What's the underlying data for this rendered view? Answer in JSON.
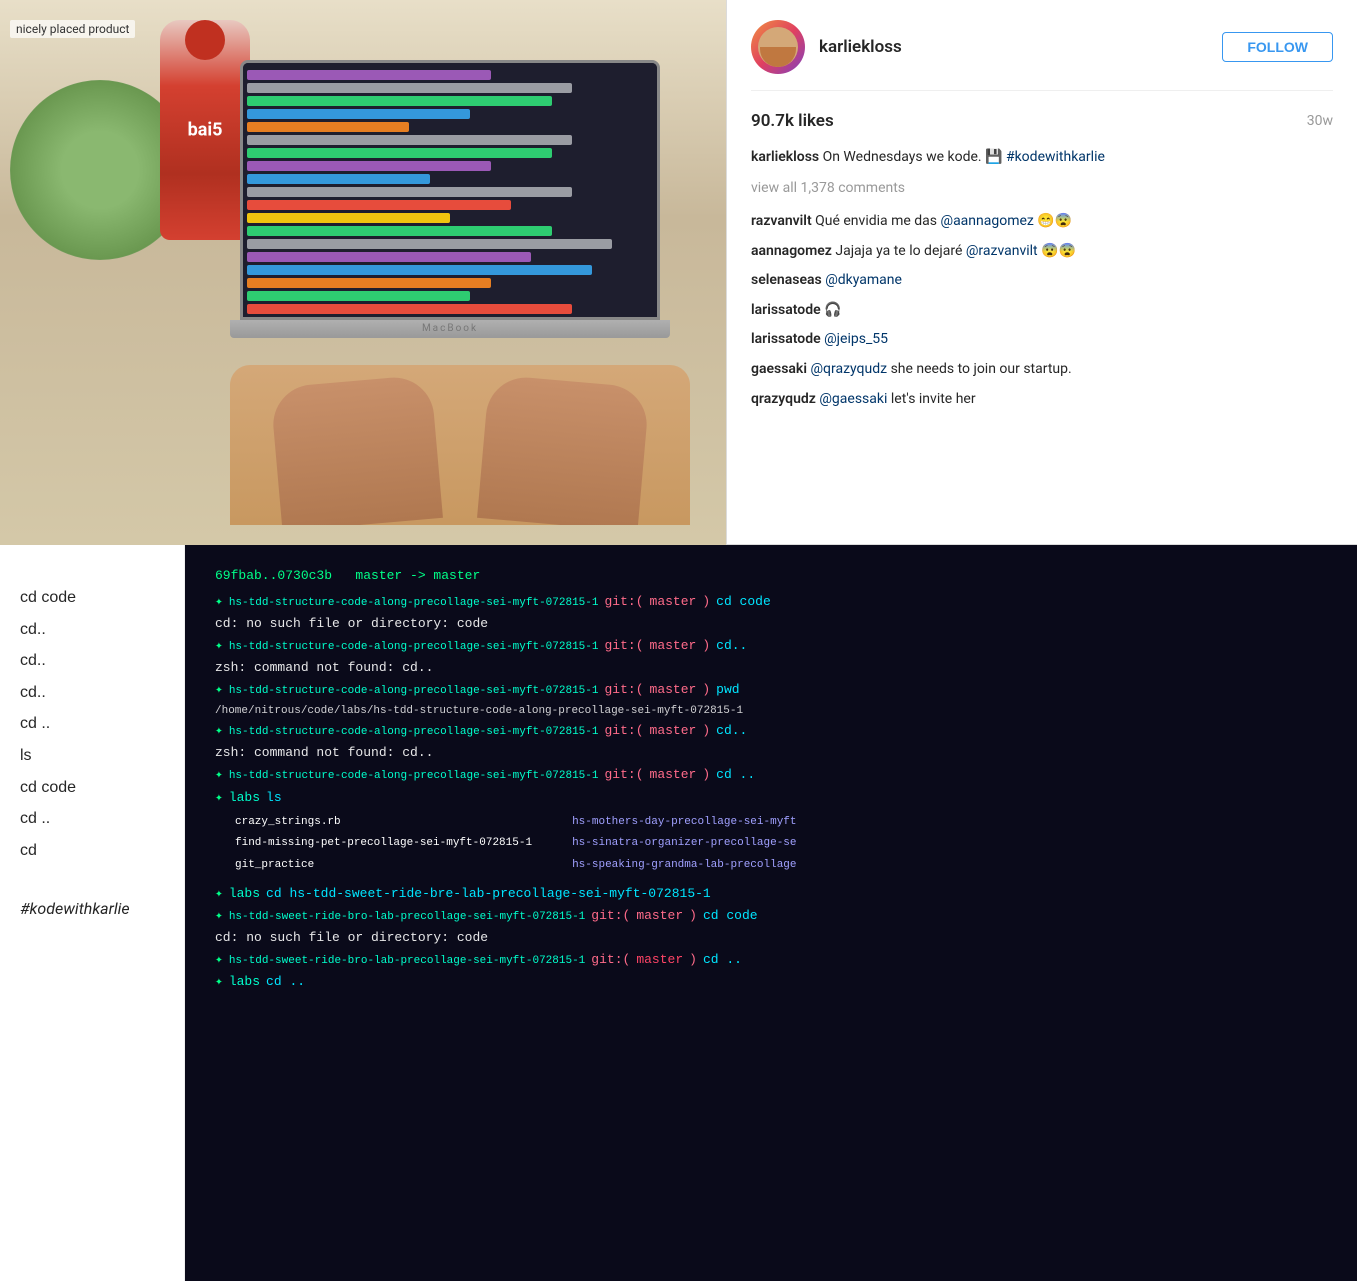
{
  "page": {
    "top_photo": {
      "product_label": "nicely placed product",
      "bottle_brand": "bai5",
      "laptop_brand": "MacBook"
    },
    "instagram": {
      "username": "karliekloss",
      "follow_btn": "FOLLOW",
      "likes": "90.7k likes",
      "time_ago": "30w",
      "caption_user": "karliekloss",
      "caption_text": "On Wednesdays we kode. 💾",
      "caption_hashtag": "#kodewithkarlie",
      "view_comments": "view all 1,378 comments",
      "comments": [
        {
          "user": "razvanvilt",
          "text": "Qué envidia me das @aannagomez 😁😨"
        },
        {
          "user": "aannagomez",
          "text": "Jajaja ya te lo dejaré @razvanvilt 😨😨"
        },
        {
          "user": "selenaseas",
          "text": "@dkyamane"
        },
        {
          "user": "larissatode",
          "text": "🎧"
        },
        {
          "user": "larissatode",
          "text": "@jeips_55"
        },
        {
          "user": "gaessaki",
          "text": "@qrazyqudz she needs to join our startup."
        },
        {
          "user": "qrazyqudz",
          "text": "@gaessaki let's invite her"
        }
      ]
    },
    "bottom": {
      "left_commands": [
        "cd code",
        "cd..",
        "cd..",
        "cd..",
        "cd ..",
        "ls",
        "cd code",
        "cd ..",
        "cd"
      ],
      "hashtag": "#kodewithkarlie",
      "terminal_lines": [
        {
          "type": "header",
          "text": "69fbab..0730c3b  master -> master"
        },
        {
          "type": "prompt",
          "prompt": "hs-tdd-structure-code-along-precollage-sei-myft-072815-1 git:(master)",
          "cmd": "cd code"
        },
        {
          "type": "error",
          "text": "cd: no such file or directory: code"
        },
        {
          "type": "prompt",
          "prompt": "hs-tdd-structure-code-along-precollage-sei-myft-072815-1 git:(master)",
          "cmd": "cd.."
        },
        {
          "type": "error",
          "text": "zsh: command not found: cd.."
        },
        {
          "type": "prompt",
          "prompt": "hs-tdd-structure-code-along-precollage-sei-myft-072815-1 git:(master)",
          "cmd": "cd.."
        },
        {
          "type": "error",
          "text": "zsh: command not found: cd.."
        },
        {
          "type": "prompt",
          "prompt": "hs-tdd-structure-code-along-precollage-sei-myft-072815-1 git:(master)",
          "cmd": "pwd"
        },
        {
          "type": "path",
          "text": "/home/nitrous/code/labs/hs-tdd-structure-code-along-precollage-sei-myft-072815-1"
        },
        {
          "type": "prompt",
          "prompt": "hs-tdd-structure-code-along-precollage-sei-myft-072815-1 git:(master)",
          "cmd": "cd.."
        },
        {
          "type": "error",
          "text": "zsh: command not found: cd.."
        },
        {
          "type": "prompt",
          "prompt": "hs-tdd-structure-code-along-precollage-sei-myft-072815-1 git:(master)",
          "cmd": "cd .."
        },
        {
          "type": "bullet",
          "cmd": "labs",
          "action": "ls"
        },
        {
          "type": "file_row",
          "files": [
            "crazy_strings.rb",
            "hs-mothers-day-precollage-sei-myft",
            "find-missing-pet-precollage-sei-myft-072815-1",
            "hs-sinatra-organizer-precollage-se",
            "git_practice",
            "hs-speaking-grandma-lab-precollage"
          ]
        },
        {
          "type": "bullet-cmd",
          "bullet": "labs",
          "cmd": "cd hs-tdd-sweet-ride-bre-lab-precollage-sei-myft-072815-1"
        },
        {
          "type": "prompt",
          "prompt": "hs-tdd-sweet-ride-bro-lab-precollage-sei-myft-072815-1 git:(master)",
          "cmd": "cd code"
        },
        {
          "type": "error",
          "text": "cd: no such file or directory: code"
        },
        {
          "type": "prompt",
          "prompt": "hs-tdd-sweet-ride-bro-lab-precollage-sei-myft-072815-1 git:(master)",
          "cmd": "cd .."
        },
        {
          "type": "bullet-cd",
          "bullet": "labs",
          "cmd": "cd .."
        }
      ]
    }
  }
}
